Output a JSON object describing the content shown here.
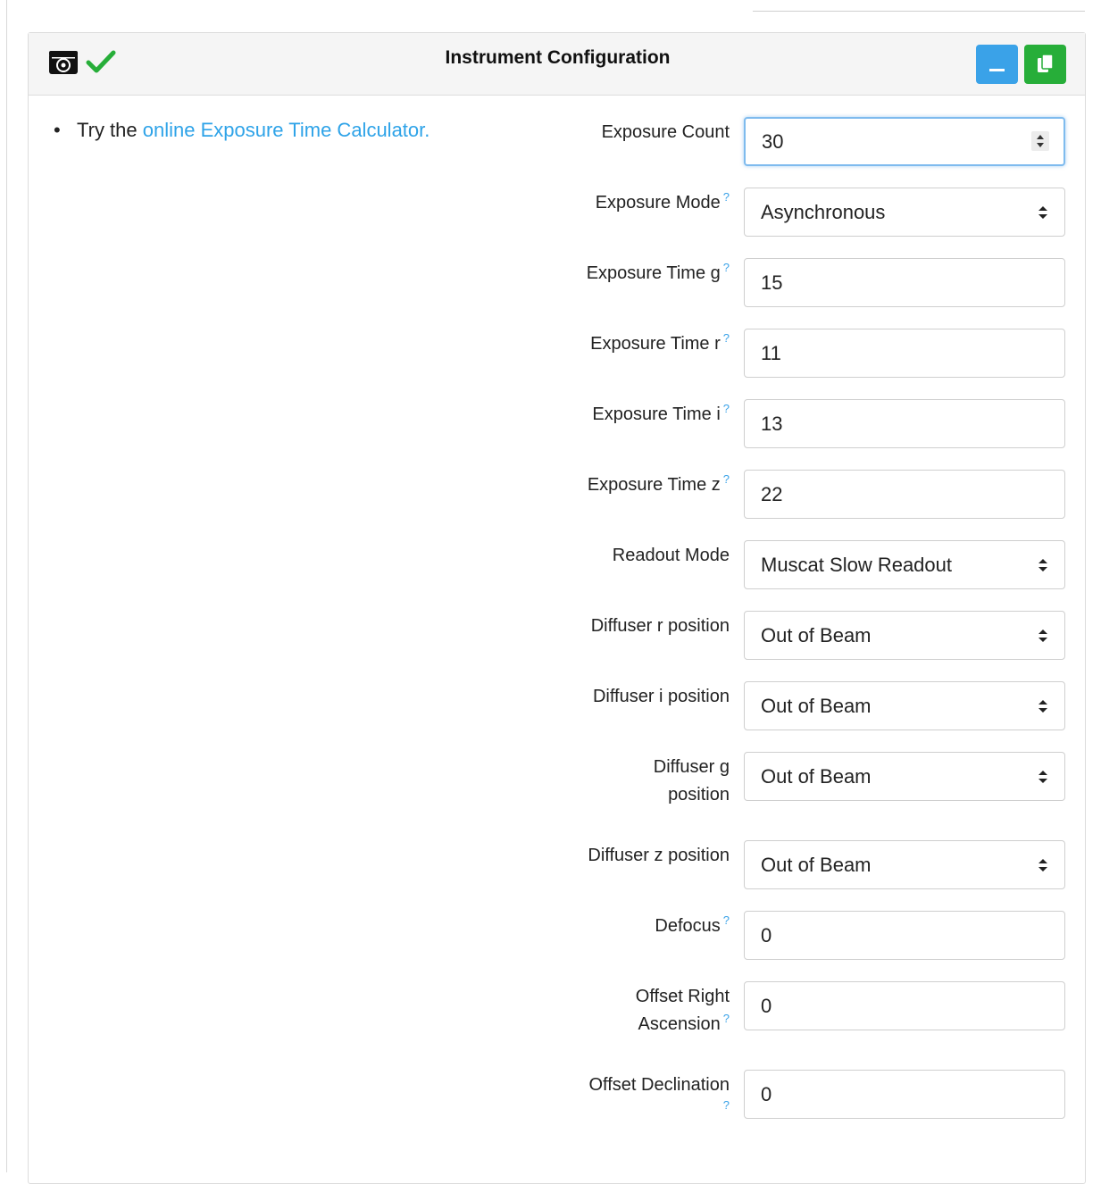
{
  "header": {
    "title": "Instrument Configuration",
    "minimize_label": "_",
    "colors": {
      "minimize": "#3aa2e8",
      "copy": "#27ae39",
      "check": "#27ae39"
    },
    "icons": [
      "camera-icon",
      "check-icon",
      "minimize-icon",
      "copy-icon"
    ]
  },
  "tip": {
    "bullet": "•",
    "prefix": "Try the ",
    "link": "online Exposure Time Calculator."
  },
  "fields": [
    {
      "label": "Exposure Count",
      "value": "30",
      "kind": "number",
      "help": false
    },
    {
      "label": "Exposure Mode",
      "value": "Asynchronous",
      "kind": "select",
      "help": true
    },
    {
      "label": "Exposure Time g",
      "value": "15",
      "kind": "text",
      "help": true
    },
    {
      "label": "Exposure Time r",
      "value": "11",
      "kind": "text",
      "help": true
    },
    {
      "label": "Exposure Time i",
      "value": "13",
      "kind": "text",
      "help": true
    },
    {
      "label": "Exposure Time z",
      "value": "22",
      "kind": "text",
      "help": true
    },
    {
      "label": "Readout Mode",
      "value": "Muscat Slow Readout",
      "kind": "select",
      "help": false
    },
    {
      "label": "Diffuser r position",
      "value": "Out of Beam",
      "kind": "select",
      "help": false
    },
    {
      "label": "Diffuser i position",
      "value": "Out of Beam",
      "kind": "select",
      "help": false
    },
    {
      "label_line1": "Diffuser g",
      "label_line2": "position",
      "value": "Out of Beam",
      "kind": "select",
      "help": false
    },
    {
      "label": "Diffuser z position",
      "value": "Out of Beam",
      "kind": "select",
      "help": false
    },
    {
      "label": "Defocus",
      "value": "0",
      "kind": "text",
      "help": true
    },
    {
      "label_line1": "Offset Right",
      "label_line2": "Ascension",
      "value": "0",
      "kind": "text",
      "help": true
    },
    {
      "label": "Offset Declination",
      "value": "0",
      "kind": "text",
      "help": true
    }
  ],
  "help_mark": "?"
}
